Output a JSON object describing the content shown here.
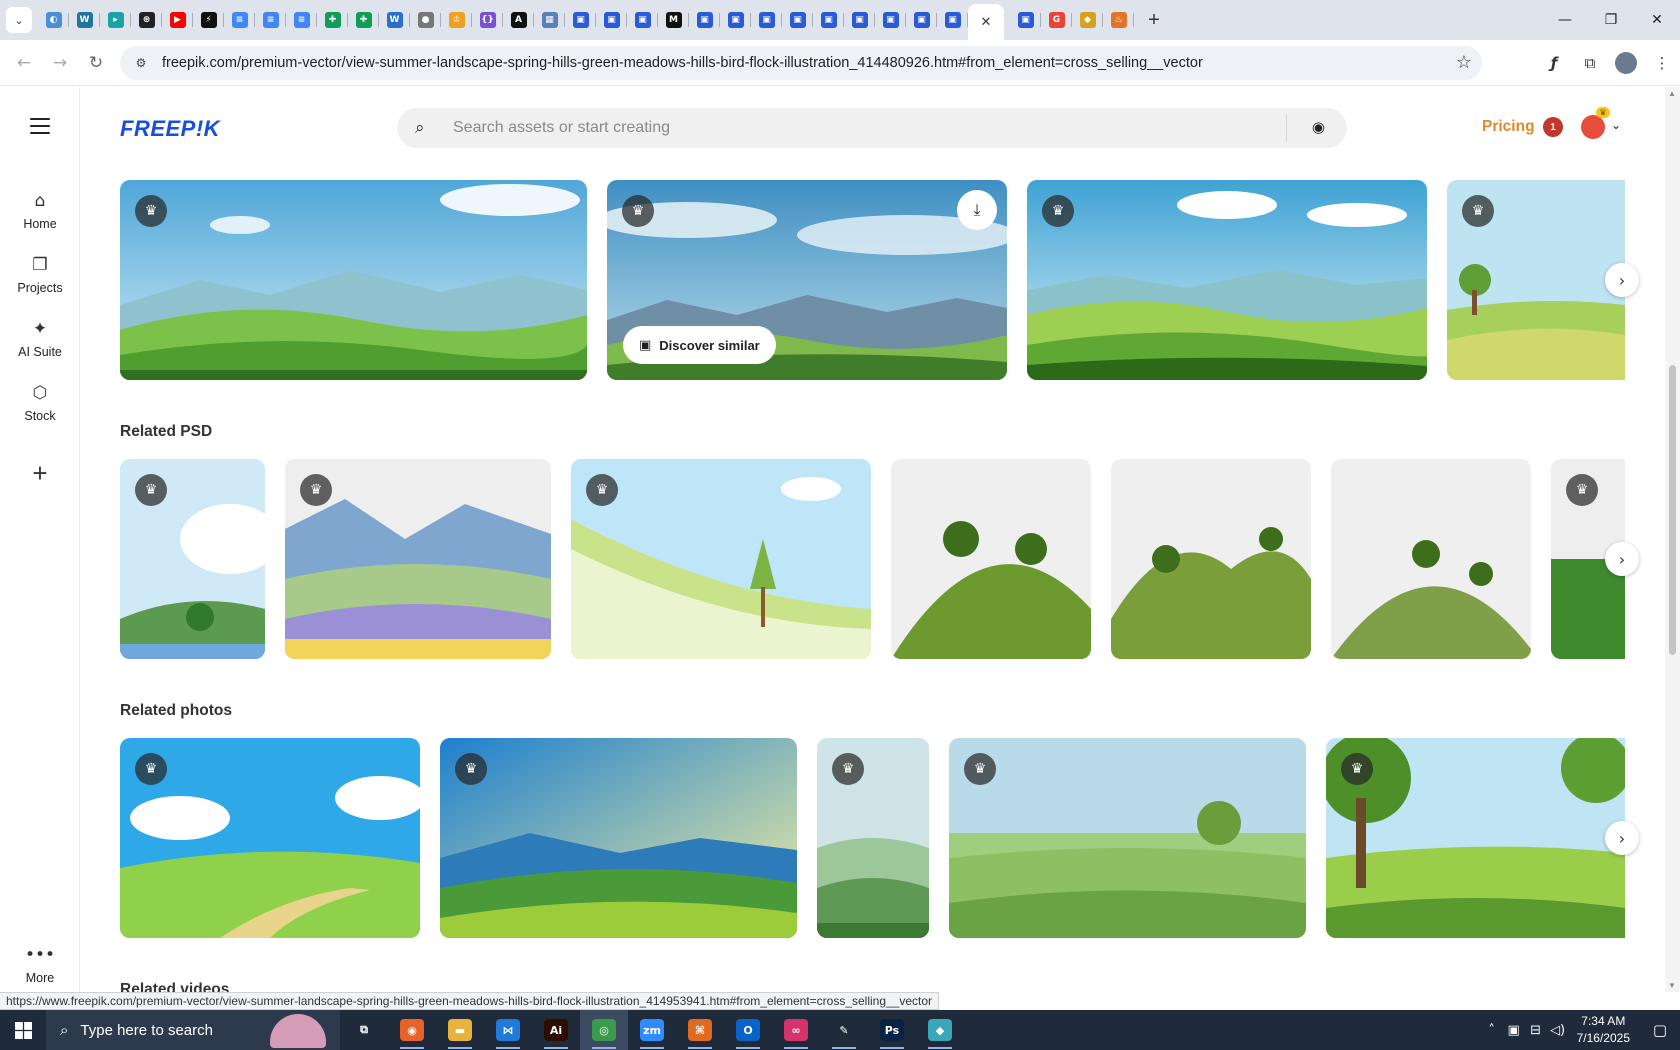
{
  "browser": {
    "tabs": [
      {
        "icon": "world-icon",
        "color": "#4a90d9",
        "glyph": "◐"
      },
      {
        "icon": "wordpress-icon",
        "color": "#21759b",
        "glyph": "W"
      },
      {
        "icon": "arrow-app-icon",
        "color": "#1aa3a3",
        "glyph": "▸"
      },
      {
        "icon": "openai-icon",
        "color": "#222222",
        "glyph": "⊛"
      },
      {
        "icon": "youtube-icon",
        "color": "#ff0000",
        "glyph": "▶"
      },
      {
        "icon": "bolt-icon",
        "color": "#111111",
        "glyph": "⚡"
      },
      {
        "icon": "google-docs-icon",
        "color": "#4285f4",
        "glyph": "≡"
      },
      {
        "icon": "google-docs-icon",
        "color": "#4285f4",
        "glyph": "≡"
      },
      {
        "icon": "google-docs-icon",
        "color": "#4285f4",
        "glyph": "≡"
      },
      {
        "icon": "google-sheets-icon",
        "color": "#0f9d58",
        "glyph": "✚"
      },
      {
        "icon": "google-sheets-icon",
        "color": "#0f9d58",
        "glyph": "✚"
      },
      {
        "icon": "wordtune-icon",
        "color": "#2c6ecb",
        "glyph": "W"
      },
      {
        "icon": "globe-icon",
        "color": "#777777",
        "glyph": "●"
      },
      {
        "icon": "crown-icon",
        "color": "#f0a020",
        "glyph": "♔"
      },
      {
        "icon": "code-icon",
        "color": "#7a4fd6",
        "glyph": "{}"
      },
      {
        "icon": "anthropic-icon",
        "color": "#111111",
        "glyph": "A"
      },
      {
        "icon": "table-icon",
        "color": "#5b7fb9",
        "glyph": "▦"
      },
      {
        "icon": "form-icon",
        "color": "#2a5bd7",
        "glyph": "▣"
      },
      {
        "icon": "form-icon",
        "color": "#2a5bd7",
        "glyph": "▣"
      },
      {
        "icon": "form-icon",
        "color": "#2a5bd7",
        "glyph": "▣"
      },
      {
        "icon": "medium-icon",
        "color": "#111111",
        "glyph": "M"
      },
      {
        "icon": "form-icon",
        "color": "#2a5bd7",
        "glyph": "▣"
      },
      {
        "icon": "form-icon",
        "color": "#2a5bd7",
        "glyph": "▣"
      },
      {
        "icon": "form-icon",
        "color": "#2a5bd7",
        "glyph": "▣"
      },
      {
        "icon": "form-icon",
        "color": "#2a5bd7",
        "glyph": "▣"
      },
      {
        "icon": "form-icon",
        "color": "#2a5bd7",
        "glyph": "▣"
      },
      {
        "icon": "form-icon",
        "color": "#2a5bd7",
        "glyph": "▣"
      },
      {
        "icon": "form-icon",
        "color": "#2a5bd7",
        "glyph": "▣"
      },
      {
        "icon": "form-icon",
        "color": "#2a5bd7",
        "glyph": "▣"
      },
      {
        "icon": "form-icon",
        "color": "#2a5bd7",
        "glyph": "▣"
      }
    ],
    "active_tab_close": "✕",
    "tabs_after": [
      {
        "icon": "form-icon",
        "color": "#2a5bd7",
        "glyph": "▣"
      },
      {
        "icon": "google-icon",
        "color": "#ea4335",
        "glyph": "G"
      },
      {
        "icon": "extension-app-icon",
        "color": "#d6a21f",
        "glyph": "◆"
      },
      {
        "icon": "fire-icon",
        "color": "#e0742a",
        "glyph": "♨"
      }
    ],
    "url": "freepik.com/premium-vector/view-summer-landscape-spring-hills-green-meadows-hills-bird-flock-illustration_414480926.htm#from_element=cross_selling__vector",
    "status_url": "https://www.freepik.com/premium-vector/view-summer-landscape-spring-hills-green-meadows-hills-bird-flock-illustration_414953941.htm#from_element=cross_selling__vector"
  },
  "sidebar": {
    "items": [
      {
        "label": "Home",
        "icon": "home-icon",
        "glyph": "⌂"
      },
      {
        "label": "Projects",
        "icon": "projects-icon",
        "glyph": "❐"
      },
      {
        "label": "AI Suite",
        "icon": "sparkle-icon",
        "glyph": "✦"
      },
      {
        "label": "Stock",
        "icon": "stock-icon",
        "glyph": "⬡"
      }
    ],
    "more_label": "More"
  },
  "header": {
    "logo": "FREEP!K",
    "search_placeholder": "Search assets or start creating",
    "pricing": "Pricing",
    "notification_count": "1"
  },
  "sections": {
    "vectors_discover": "Discover similar",
    "related_psd": "Related PSD",
    "related_photos": "Related photos",
    "related_videos": "Related videos"
  },
  "taskbar": {
    "search_text": "Type here to search",
    "time": "7:34 AM",
    "date": "7/16/2025",
    "apps": [
      {
        "icon": "task-view-icon",
        "color": "transparent",
        "glyph": "⧉"
      },
      {
        "icon": "firefox-icon",
        "color": "#e8622a",
        "glyph": "◉"
      },
      {
        "icon": "file-explorer-icon",
        "color": "#e8b33a",
        "glyph": "▬"
      },
      {
        "icon": "vscode-icon",
        "color": "#1f7ad8",
        "glyph": "⋈"
      },
      {
        "icon": "illustrator-icon",
        "color": "#2d0d00",
        "glyph": "Ai"
      },
      {
        "icon": "chrome-icon",
        "color": "#3b9b4a",
        "glyph": "◎"
      },
      {
        "icon": "zoom-icon",
        "color": "#2d8cff",
        "glyph": "zm"
      },
      {
        "icon": "sublime-icon",
        "color": "#e06a1f",
        "glyph": "⌘"
      },
      {
        "icon": "outlook-icon",
        "color": "#0a64c8",
        "glyph": "O"
      },
      {
        "icon": "creative-cloud-icon",
        "color": "#d6336c",
        "glyph": "∞"
      },
      {
        "icon": "pen-tool-icon",
        "color": "transparent",
        "glyph": "✎"
      },
      {
        "icon": "photoshop-icon",
        "color": "#0a2342",
        "glyph": "Ps"
      },
      {
        "icon": "app-diamond-icon",
        "color": "#3aa6b9",
        "glyph": "◆"
      }
    ]
  }
}
